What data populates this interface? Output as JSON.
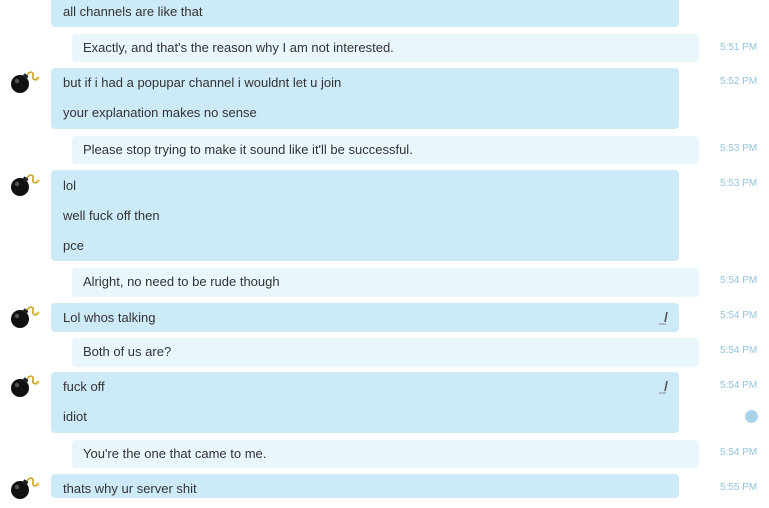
{
  "messages": [
    {
      "lines": [
        "all channels are like that"
      ]
    },
    {
      "lines": [
        "Exactly, and that's the reason why I am not interested."
      ],
      "time": "5:51 PM"
    },
    {
      "lines": [
        "but if i had a popupar channel i wouldnt let u join",
        "your explanation makes no sense"
      ],
      "time": "5:52 PM"
    },
    {
      "lines": [
        "Please stop trying to make it sound like it'll be successful."
      ],
      "time": "5:53 PM"
    },
    {
      "lines": [
        "lol",
        "well fuck off then",
        "pce"
      ],
      "time": "5:53 PM"
    },
    {
      "lines": [
        "Alright, no need to be rude though"
      ],
      "time": "5:54 PM"
    },
    {
      "lines": [
        "Lol whos talking"
      ],
      "time": "5:54 PM"
    },
    {
      "lines": [
        "Both of us are?"
      ],
      "time": "5:54 PM"
    },
    {
      "lines": [
        "fuck off",
        "idiot"
      ],
      "time": "5:54 PM"
    },
    {
      "lines": [
        "You're the one that came to me."
      ],
      "time": "5:54 PM"
    },
    {
      "lines": [
        "thats why ur server shit"
      ],
      "time": "5:55 PM"
    }
  ],
  "icons": {
    "avatar": "bomb-avatar-icon",
    "edit": "edit-pencil-icon",
    "scroll": "scroll-down-icon"
  },
  "colors": {
    "incoming_bubble": "#cdeaf8",
    "outgoing_bubble": "#e9f6fc",
    "timestamp": "#94c4dd",
    "text": "#333333"
  }
}
